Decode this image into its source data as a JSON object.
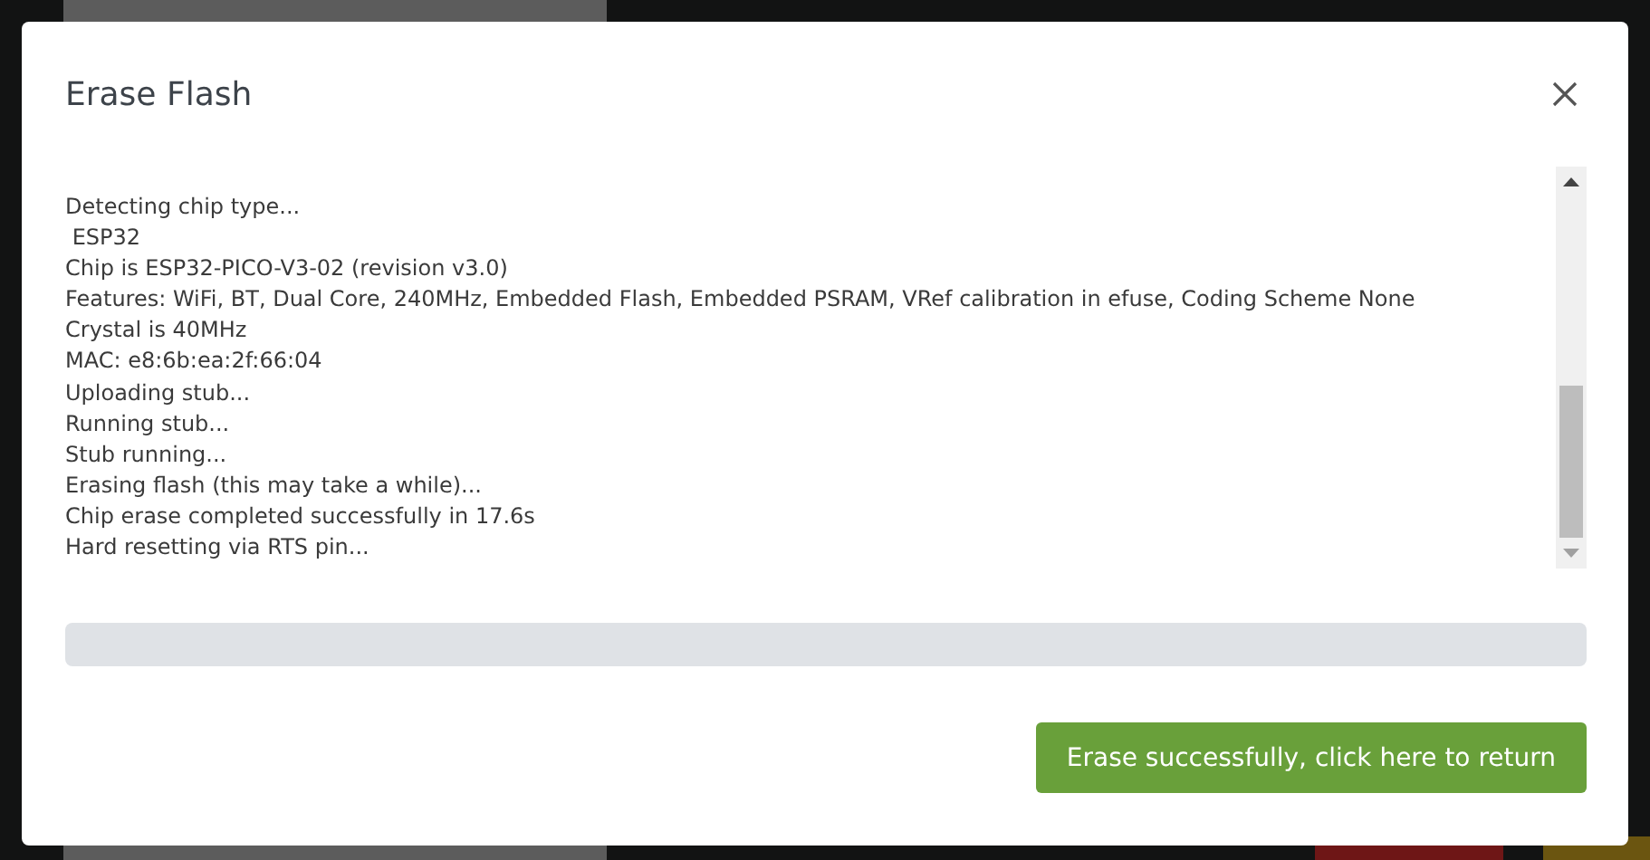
{
  "dialog": {
    "title": "Erase Flash",
    "log": [
      "Detecting chip type...",
      " ESP32",
      "Chip is ESP32-PICO-V3-02 (revision v3.0)",
      "Features: WiFi, BT, Dual Core, 240MHz, Embedded Flash, Embedded PSRAM, VRef calibration in efuse, Coding Scheme None",
      "Crystal is 40MHz",
      "MAC: e8:6b:ea:2f:66:04",
      "Uploading stub...",
      "Running stub...",
      "Stub running...",
      "Erasing flash (this may take a while)...",
      "Chip erase completed successfully in 17.6s",
      "Hard resetting via RTS pin..."
    ],
    "progress": {
      "level": 0
    },
    "button": "Erase successfully, click here to return"
  }
}
